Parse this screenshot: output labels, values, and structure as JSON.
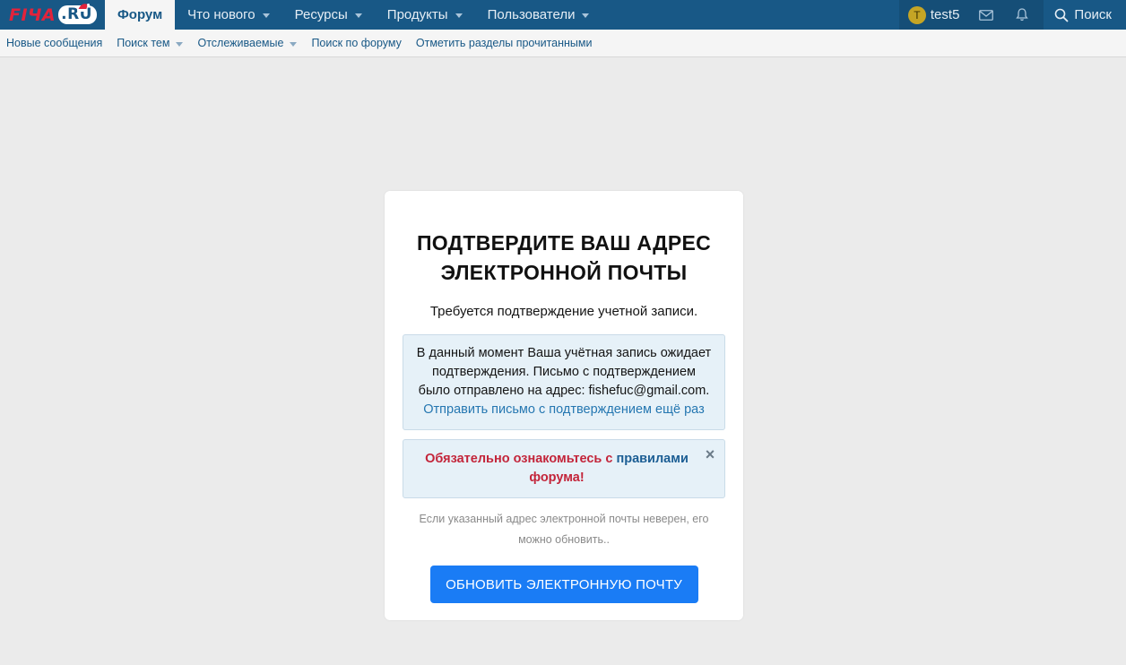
{
  "topbar": {
    "logo": {
      "main": "FIЧА",
      "suffix": ".RU"
    },
    "tabs": [
      {
        "label": "Форум",
        "active": true,
        "dropdown": false
      },
      {
        "label": "Что нового",
        "active": false,
        "dropdown": true
      },
      {
        "label": "Ресурсы",
        "active": false,
        "dropdown": true
      },
      {
        "label": "Продукты",
        "active": false,
        "dropdown": true
      },
      {
        "label": "Пользователи",
        "active": false,
        "dropdown": true
      }
    ],
    "user": {
      "avatar_letter": "T",
      "name": "test5"
    },
    "icons": [
      "envelope-icon",
      "bell-icon",
      "search-icon"
    ],
    "search_label": "Поиск"
  },
  "subnav": {
    "items": [
      {
        "label": "Новые сообщения",
        "dropdown": false
      },
      {
        "label": "Поиск тем",
        "dropdown": true
      },
      {
        "label": "Отслеживаемые",
        "dropdown": true
      },
      {
        "label": "Поиск по форуму",
        "dropdown": false
      },
      {
        "label": "Отметить разделы прочитанными",
        "dropdown": false
      }
    ]
  },
  "card": {
    "title_line1": "ПОДТВЕРДИТЕ ВАШ АДРЕС",
    "title_line2": "ЭЛЕКТРОННОЙ ПОЧТЫ",
    "subtitle": "Требуется подтверждение учетной записи.",
    "notice_line1": "В данный момент Ваша учётная запись ожидает",
    "notice_line2": "подтверждения. Письмо с подтверждением",
    "notice_line3": "было отправлено на адрес: fishefuc@gmail.com.",
    "resend_link": "Отправить письмо с подтверждением ещё раз",
    "rules_prefix": "Обязательно ознакомьтесь с ",
    "rules_link": "правилами",
    "rules_suffix": "форума!",
    "hint_line1": "Если указанный адрес электронной почты неверен, его",
    "hint_line2": "можно обновить..",
    "update_button": "ОБНОВИТЬ ЭЛЕКТРОННУЮ ПОЧТУ"
  },
  "colors": {
    "nav_bg": "#185886",
    "page_bg": "#ebebeb",
    "accent_button": "#1a7cf5",
    "rules_red": "#c3253a",
    "link": "#2577b1"
  }
}
